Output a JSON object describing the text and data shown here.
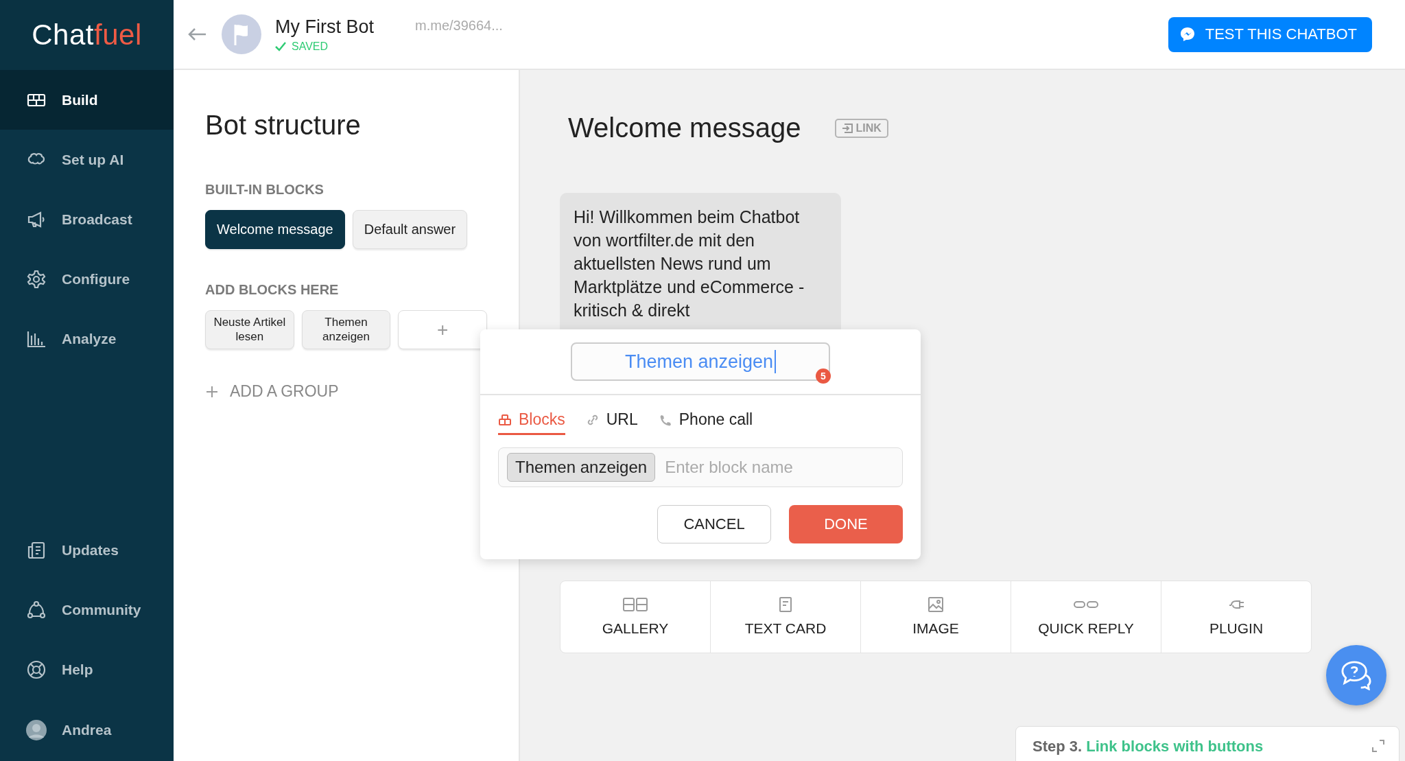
{
  "sidebar": {
    "logo": {
      "part_1": "Chat",
      "part_2": "fuel"
    },
    "items": [
      {
        "label": "Build",
        "selected": true
      },
      {
        "label": "Set up AI",
        "selected": false
      },
      {
        "label": "Broadcast",
        "selected": false
      },
      {
        "label": "Configure",
        "selected": false
      },
      {
        "label": "Analyze",
        "selected": false
      }
    ],
    "bottom_items": [
      {
        "label": "Updates",
        "selected": false
      },
      {
        "label": "Community",
        "selected": false
      },
      {
        "label": "Help",
        "selected": false
      }
    ],
    "user": {
      "name": "Andrea"
    }
  },
  "header": {
    "bot_name": "My First Bot",
    "status": "SAVED",
    "link": "m.me/39664...",
    "test_button": "TEST THIS CHATBOT"
  },
  "structure": {
    "title": "Bot structure",
    "groups": [
      {
        "title": "BUILT-IN BLOCKS",
        "blocks": [
          {
            "label": "Welcome message",
            "selected": true
          },
          {
            "label": "Default answer",
            "selected": false
          }
        ]
      },
      {
        "title": "ADD BLOCKS HERE",
        "blocks": [
          {
            "label": "Neuste Artikel lesen",
            "selected": false
          },
          {
            "label": "Themen anzeigen",
            "selected": false
          }
        ],
        "add_button": "+"
      }
    ],
    "add_group": "ADD A GROUP"
  },
  "editor": {
    "title": "Welcome message",
    "link_badge": "LINK",
    "message": "Hi! Willkommen beim Chatbot von wortfilter.de mit den aktuellsten News rund um Marktplätze und eCommerce - kritisch & direkt",
    "popup": {
      "button_title": "Themen anzeigen",
      "char_count": "5",
      "tabs": [
        {
          "label": "Blocks",
          "selected": true
        },
        {
          "label": "URL",
          "selected": false
        },
        {
          "label": "Phone call",
          "selected": false
        }
      ],
      "chips": [
        "Themen anzeigen"
      ],
      "placeholder": "Enter block name",
      "cancel": "CANCEL",
      "done": "DONE"
    },
    "toolbar": [
      {
        "label": "GALLERY"
      },
      {
        "label": "TEXT CARD"
      },
      {
        "label": "IMAGE"
      },
      {
        "label": "QUICK REPLY"
      },
      {
        "label": "PLUGIN"
      }
    ]
  },
  "tutorial": {
    "step": "Step 3.",
    "text": "Link blocks with buttons"
  }
}
